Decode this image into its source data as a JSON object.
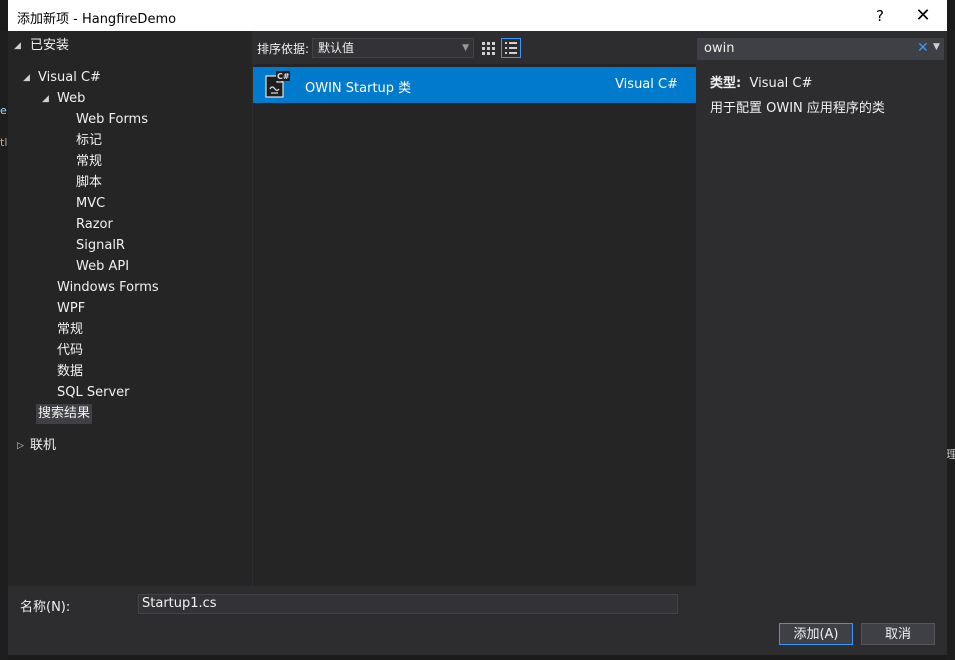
{
  "background": {
    "fragment_left_1": "e",
    "fragment_left_2": "tl",
    "fragment_right": "理"
  },
  "dialog": {
    "title": "添加新项 - HangfireDemo",
    "help_label": "?",
    "close_label": "✕"
  },
  "tree": {
    "installed": "已安装",
    "visual_csharp": "Visual C#",
    "web": "Web",
    "web_forms": "Web Forms",
    "tag": "标记",
    "general": "常规",
    "script": "脚本",
    "mvc": "MVC",
    "razor": "Razor",
    "signalr": "SignalR",
    "web_api": "Web API",
    "windows_forms": "Windows Forms",
    "wpf": "WPF",
    "general2": "常规",
    "code": "代码",
    "data": "数据",
    "sql_server": "SQL Server",
    "search_results": "搜索结果",
    "online": "联机"
  },
  "toolbar": {
    "sort_label": "排序依据:",
    "sort_value": "默认值",
    "grid_view": "grid-view-icon",
    "list_view": "list-view-icon"
  },
  "search": {
    "value": "owin",
    "clear": "✕"
  },
  "templates": [
    {
      "name": "OWIN Startup 类",
      "language": "Visual C#",
      "icon_badge": "C#"
    }
  ],
  "details": {
    "type_key": "类型:",
    "type_value": "Visual C#",
    "description": "用于配置 OWIN 应用程序的类"
  },
  "footer": {
    "name_label": "名称(N):",
    "name_value": "Startup1.cs",
    "add_label": "添加(A)",
    "cancel_label": "取消"
  },
  "colors": {
    "selection": "#007acc",
    "accent": "#3399ff",
    "dialog_bg": "#2d2d30",
    "pane_bg": "#252526"
  }
}
